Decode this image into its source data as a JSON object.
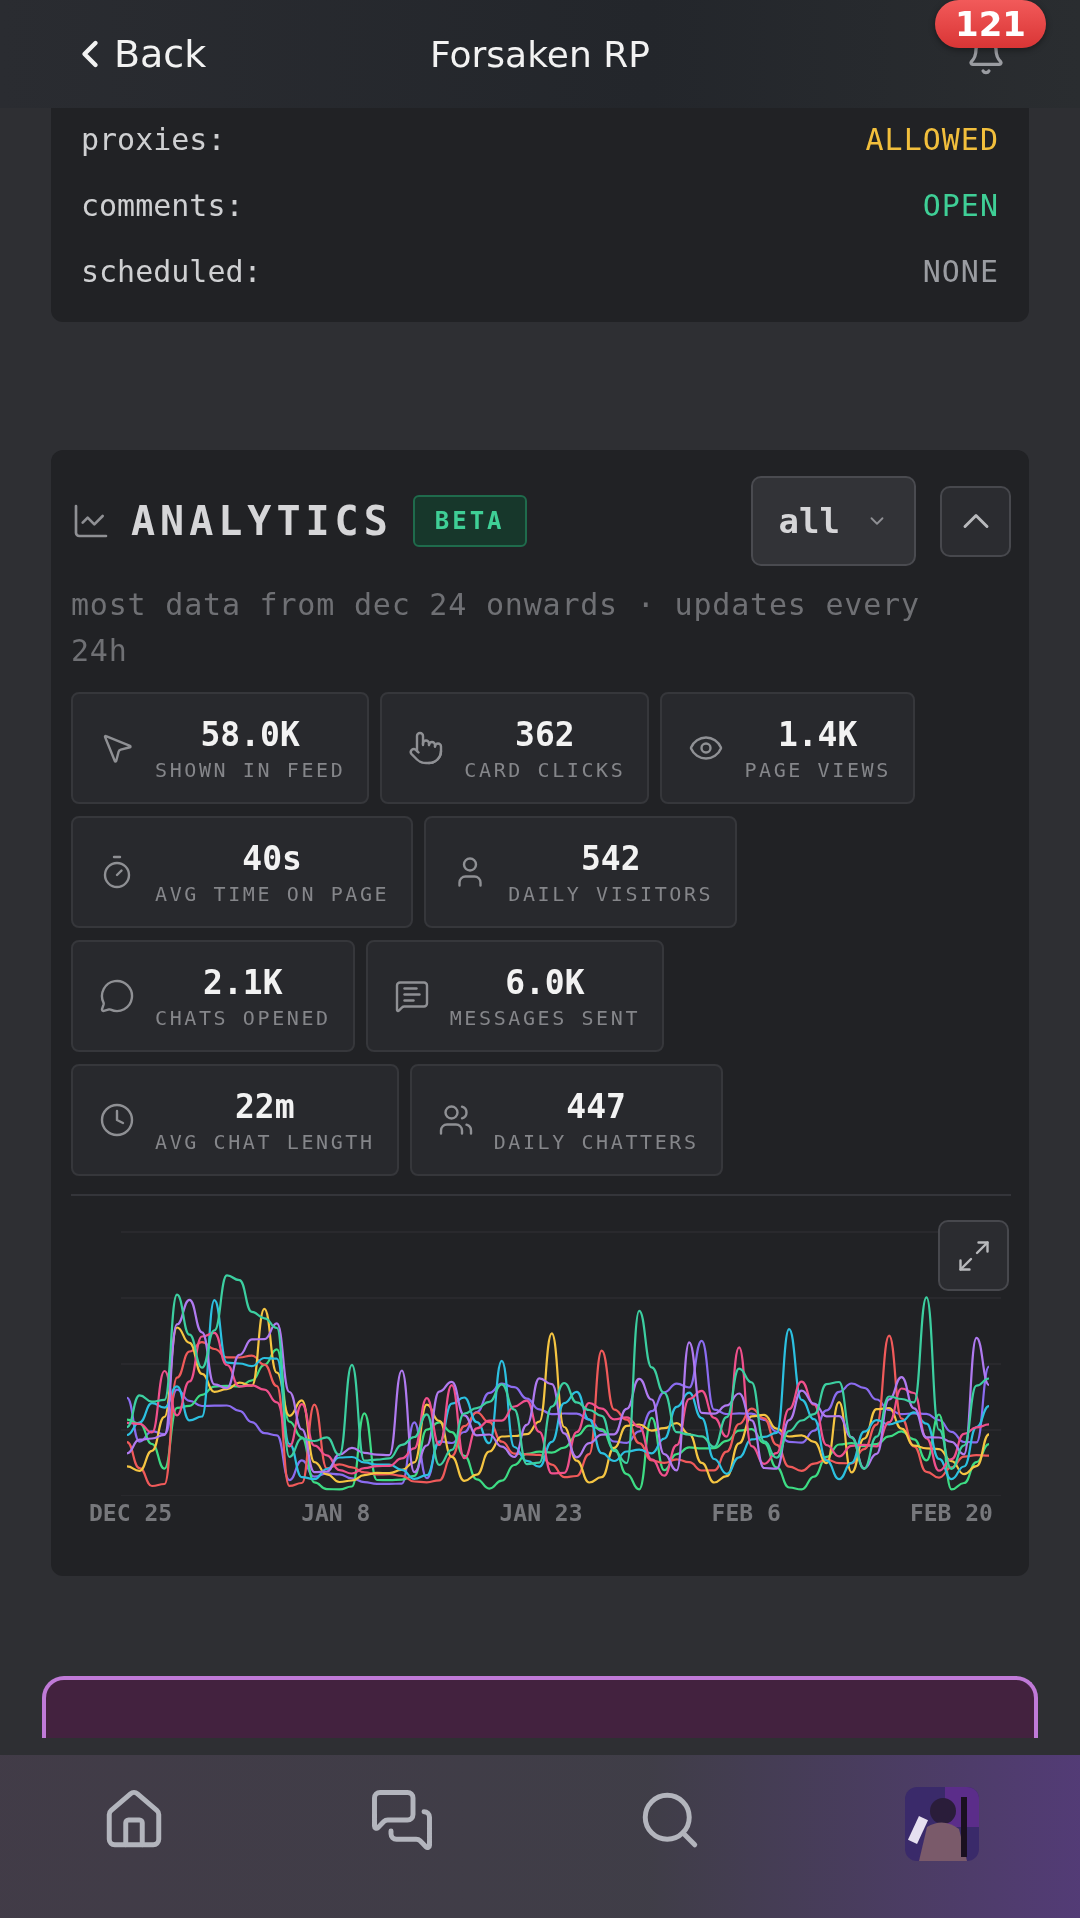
{
  "header": {
    "back": "Back",
    "title": "Forsaken RP",
    "notification_count": "121"
  },
  "settings": [
    {
      "label": "proxies:",
      "value": "ALLOWED",
      "color": "#f2bf3c"
    },
    {
      "label": "comments:",
      "value": "OPEN",
      "color": "#3fcf96"
    },
    {
      "label": "scheduled:",
      "value": "NONE",
      "color": "#9a9ca1"
    }
  ],
  "analytics": {
    "title": "ANALYTICS",
    "badge": "BETA",
    "range": "all",
    "expanded": true,
    "subtitle": "most data from dec 24 onwards · updates every 24h",
    "stat_rows": [
      [
        {
          "value": "58.0K",
          "label": "SHOWN IN FEED"
        },
        {
          "value": "362",
          "label": "CARD CLICKS"
        },
        {
          "value": "1.4K",
          "label": "PAGE VIEWS"
        }
      ],
      [
        {
          "value": "40s",
          "label": "AVG TIME ON PAGE"
        },
        {
          "value": "542",
          "label": "DAILY VISITORS"
        }
      ],
      [
        {
          "value": "2.1K",
          "label": "CHATS OPENED"
        },
        {
          "value": "6.0K",
          "label": "MESSAGES SENT"
        }
      ],
      [
        {
          "value": "22m",
          "label": "AVG CHAT LENGTH"
        },
        {
          "value": "447",
          "label": "DAILY CHATTERS"
        }
      ]
    ],
    "x_labels": [
      "DEC 25",
      "JAN 8",
      "JAN 23",
      "FEB 6",
      "FEB 20"
    ]
  },
  "nav": [
    {
      "kind": "home"
    },
    {
      "kind": "chats"
    },
    {
      "kind": "search"
    },
    {
      "kind": "avatar"
    }
  ]
}
